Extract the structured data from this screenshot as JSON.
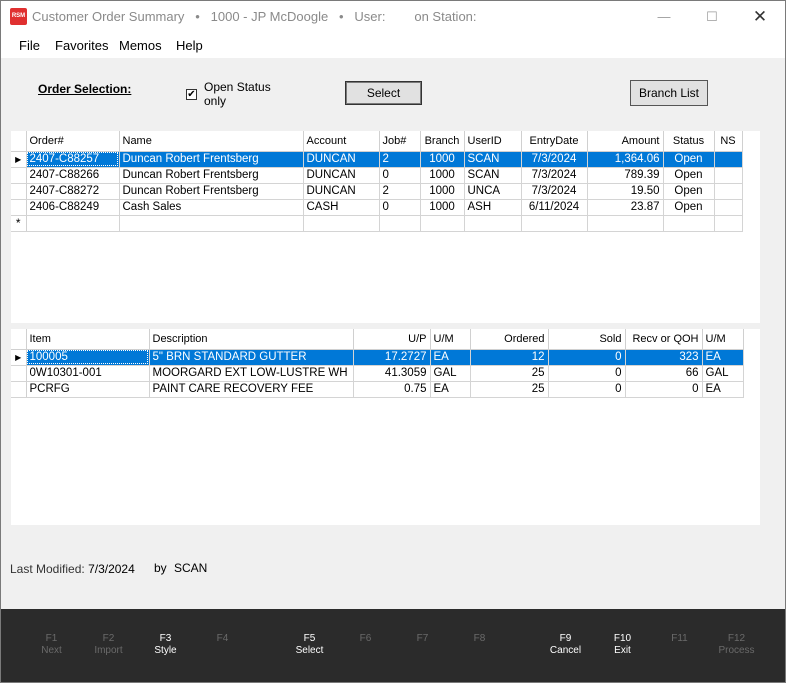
{
  "window": {
    "logo_text": "RSM",
    "title": "Customer Order Summary   •   1000 - JP McDoogle   •   User:        on Station:",
    "min_glyph": "—",
    "max_glyph": "☐",
    "close_glyph": "✕"
  },
  "menu": [
    "File",
    "Favorites",
    "Memos",
    "Help"
  ],
  "order_selection": {
    "label": "Order Selection:",
    "open_status_label": "Open Status only",
    "open_status_checked": true,
    "check_glyph": "✔",
    "select_button": "Select",
    "branch_list_button": "Branch List"
  },
  "orders": {
    "columns": [
      "Order#",
      "Name",
      "Account",
      "Job#",
      "Branch",
      "UserID",
      "EntryDate",
      "Amount",
      "Status",
      "NS"
    ],
    "rows": [
      [
        "2407-C88257",
        "Duncan Robert Frentsberg",
        "DUNCAN",
        "2",
        "1000",
        "SCAN",
        "7/3/2024",
        "1,364.06",
        "Open",
        ""
      ],
      [
        "2407-C88266",
        "Duncan Robert Frentsberg",
        "DUNCAN",
        "0",
        "1000",
        "SCAN",
        "7/3/2024",
        "789.39",
        "Open",
        ""
      ],
      [
        "2407-C88272",
        "Duncan Robert Frentsberg",
        "DUNCAN",
        "2",
        "1000",
        "UNCA",
        "7/3/2024",
        "19.50",
        "Open",
        ""
      ],
      [
        "2406-C88249",
        "Cash Sales",
        "CASH",
        "0",
        "1000",
        "ASH",
        "6/11/2024",
        "23.87",
        "Open",
        ""
      ]
    ],
    "selected_row": 0,
    "row_pointer": "▶",
    "new_row_marker": "*"
  },
  "items": {
    "columns": [
      "Item",
      "Description",
      "U/P",
      "U/M",
      "Ordered",
      "Sold",
      "Recv or QOH",
      "U/M"
    ],
    "rows": [
      [
        "100005",
        "5\" BRN STANDARD GUTTER",
        "17.2727",
        "EA",
        "12",
        "0",
        "323",
        "EA"
      ],
      [
        "0W10301-001",
        "MOORGARD EXT LOW-LUSTRE WH",
        "41.3059",
        "GAL",
        "25",
        "0",
        "66",
        "GAL"
      ],
      [
        "PCRFG",
        "PAINT CARE RECOVERY FEE",
        "0.75",
        "EA",
        "25",
        "0",
        "0",
        "EA"
      ]
    ],
    "selected_row": 0,
    "row_pointer": "▶"
  },
  "footer": {
    "last_modified_label": "Last Modified:",
    "last_modified_value": "7/3/2024",
    "by_label": "by",
    "by_value": "SCAN"
  },
  "function_keys": [
    {
      "key": "F1",
      "label": "Next",
      "enabled": false
    },
    {
      "key": "F2",
      "label": "Import",
      "enabled": false
    },
    {
      "key": "F3",
      "label": "Style",
      "enabled": true
    },
    {
      "key": "F4",
      "label": "",
      "enabled": false
    },
    {
      "key": "F5",
      "label": "Select",
      "enabled": true
    },
    {
      "key": "F6",
      "label": "",
      "enabled": false
    },
    {
      "key": "F7",
      "label": "",
      "enabled": false
    },
    {
      "key": "F8",
      "label": "",
      "enabled": false
    },
    {
      "key": "F9",
      "label": "Cancel",
      "enabled": true
    },
    {
      "key": "F10",
      "label": "Exit",
      "enabled": true
    },
    {
      "key": "F11",
      "label": "",
      "enabled": false
    },
    {
      "key": "F12",
      "label": "Process",
      "enabled": false
    }
  ]
}
